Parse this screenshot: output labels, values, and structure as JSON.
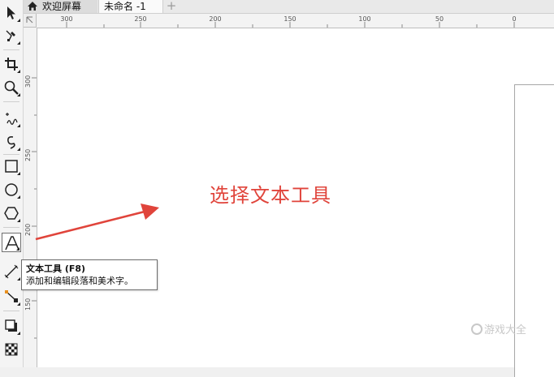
{
  "tabs": {
    "home_label": "欢迎屏幕",
    "doc_label": "未命名 -1",
    "add_label": "+"
  },
  "rulers": {
    "top": [
      "300",
      "250",
      "200",
      "150",
      "100",
      "50",
      "0"
    ],
    "left": [
      "300",
      "250",
      "200",
      "150"
    ]
  },
  "toolbox": {
    "tools": [
      {
        "name": "pick-tool",
        "icon": "pointer-icon"
      },
      {
        "name": "shape-tool",
        "icon": "node-edit-icon"
      },
      {
        "name": "crop-tool",
        "icon": "crop-icon"
      },
      {
        "name": "zoom-tool",
        "icon": "zoom-icon"
      },
      {
        "name": "freehand-tool",
        "icon": "freehand-icon"
      },
      {
        "name": "artistic-media-tool",
        "icon": "brush-curve-icon"
      },
      {
        "name": "rectangle-tool",
        "icon": "rectangle-icon"
      },
      {
        "name": "ellipse-tool",
        "icon": "ellipse-icon"
      },
      {
        "name": "polygon-tool",
        "icon": "polygon-icon"
      },
      {
        "name": "text-tool",
        "icon": "text-icon"
      },
      {
        "name": "parallel-dimension-tool",
        "icon": "dimension-icon"
      },
      {
        "name": "connector-tool",
        "icon": "connector-icon"
      },
      {
        "name": "drop-shadow-tool",
        "icon": "drop-shadow-icon"
      },
      {
        "name": "transparency-tool",
        "icon": "transparency-icon"
      }
    ],
    "active_tool": "text-tool"
  },
  "tooltip": {
    "title": "文本工具 (F8)",
    "description": "添加和编辑段落和美术字。"
  },
  "annotation": {
    "text": "选择文本工具",
    "color": "#e0443b"
  },
  "watermark": {
    "text": "游戏大全"
  }
}
